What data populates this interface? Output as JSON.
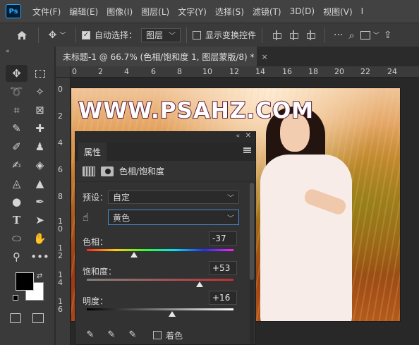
{
  "app": {
    "logo": "Ps"
  },
  "menu": [
    "文件(F)",
    "编辑(E)",
    "图像(I)",
    "图层(L)",
    "文字(Y)",
    "选择(S)",
    "滤镜(T)",
    "3D(D)",
    "视图(V)",
    "I"
  ],
  "options": {
    "auto_select_label": "自动选择：",
    "auto_select_checked": true,
    "auto_select_value": "图层",
    "show_transform_label": "显示变换控件",
    "show_transform_checked": false
  },
  "document": {
    "tab_title": "未标题-1 @ 66.7% (色相/饱和度 1, 图层蒙版/8) *",
    "close": "×",
    "ruler_top": [
      "0",
      "2",
      "4",
      "6",
      "8",
      "10",
      "12",
      "14",
      "16",
      "18",
      "20",
      "22",
      "24"
    ],
    "ruler_left": [
      "0",
      "2",
      "4",
      "6",
      "8",
      "1\n0",
      "1\n2",
      "1\n4",
      "1\n6"
    ],
    "watermark": "WWW.PSAHZ.COM"
  },
  "properties": {
    "tab": "属性",
    "adjustment_title": "色相/饱和度",
    "preset_label": "预设：",
    "preset_value": "自定",
    "channel_value": "黄色",
    "hue_label": "色相：",
    "hue_value": "-37",
    "hue_fraction": 0.32,
    "saturation_label": "饱和度：",
    "saturation_value": "+53",
    "saturation_fraction": 0.77,
    "lightness_label": "明度：",
    "lightness_value": "+16",
    "lightness_fraction": 0.58,
    "colorize_label": "着色",
    "colorize_checked": false
  },
  "colors": {
    "foreground": "#000000",
    "background": "#ffffff",
    "accent": "#31a8ff"
  }
}
